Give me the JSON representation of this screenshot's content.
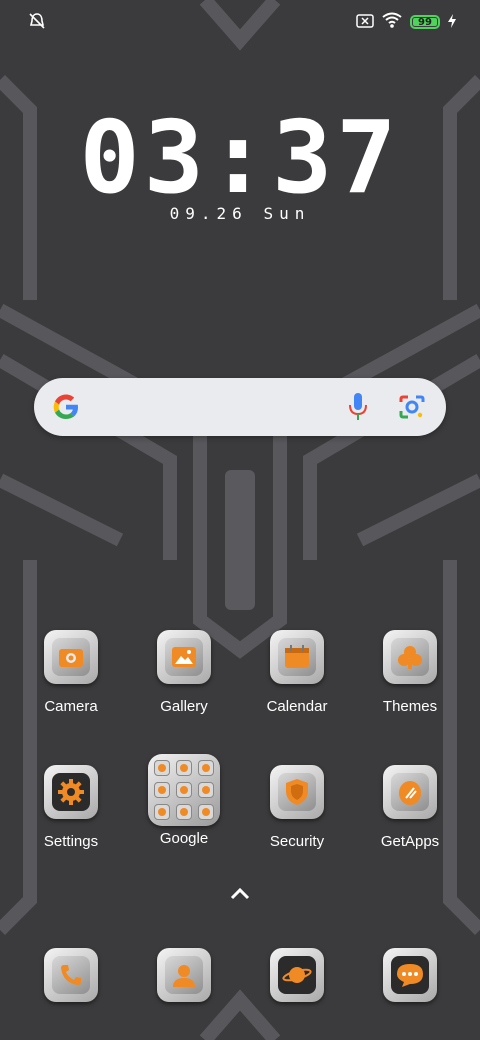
{
  "status_bar": {
    "left_icon": "alarm-off-icon",
    "right_icons": [
      "screen-cast-off-icon",
      "wifi-icon",
      "charging-bolt-icon"
    ],
    "battery_level": "99",
    "battery_color": "#4fd35c"
  },
  "clock": {
    "time": "03:37",
    "date": "09.26 Sun"
  },
  "search_bar": {
    "left_icon": "google-g-icon",
    "mic_icon": "mic-icon",
    "lens_icon": "google-lens-icon"
  },
  "apps": {
    "row1": [
      {
        "label": "Camera",
        "icon": "camera-icon"
      },
      {
        "label": "Gallery",
        "icon": "gallery-icon"
      },
      {
        "label": "Calendar",
        "icon": "calendar-icon"
      },
      {
        "label": "Themes",
        "icon": "themes-icon"
      }
    ],
    "row2": [
      {
        "label": "Settings",
        "icon": "gear-icon"
      },
      {
        "label": "Google",
        "icon": "folder-icon"
      },
      {
        "label": "Security",
        "icon": "shield-icon"
      },
      {
        "label": "GetApps",
        "icon": "getapps-icon"
      }
    ]
  },
  "dock": [
    {
      "icon": "phone-icon"
    },
    {
      "icon": "contacts-icon"
    },
    {
      "icon": "browser-planet-icon"
    },
    {
      "icon": "messages-icon"
    }
  ],
  "app_drawer_icon": "chevron-up-icon",
  "accent_color": "#f08a24"
}
